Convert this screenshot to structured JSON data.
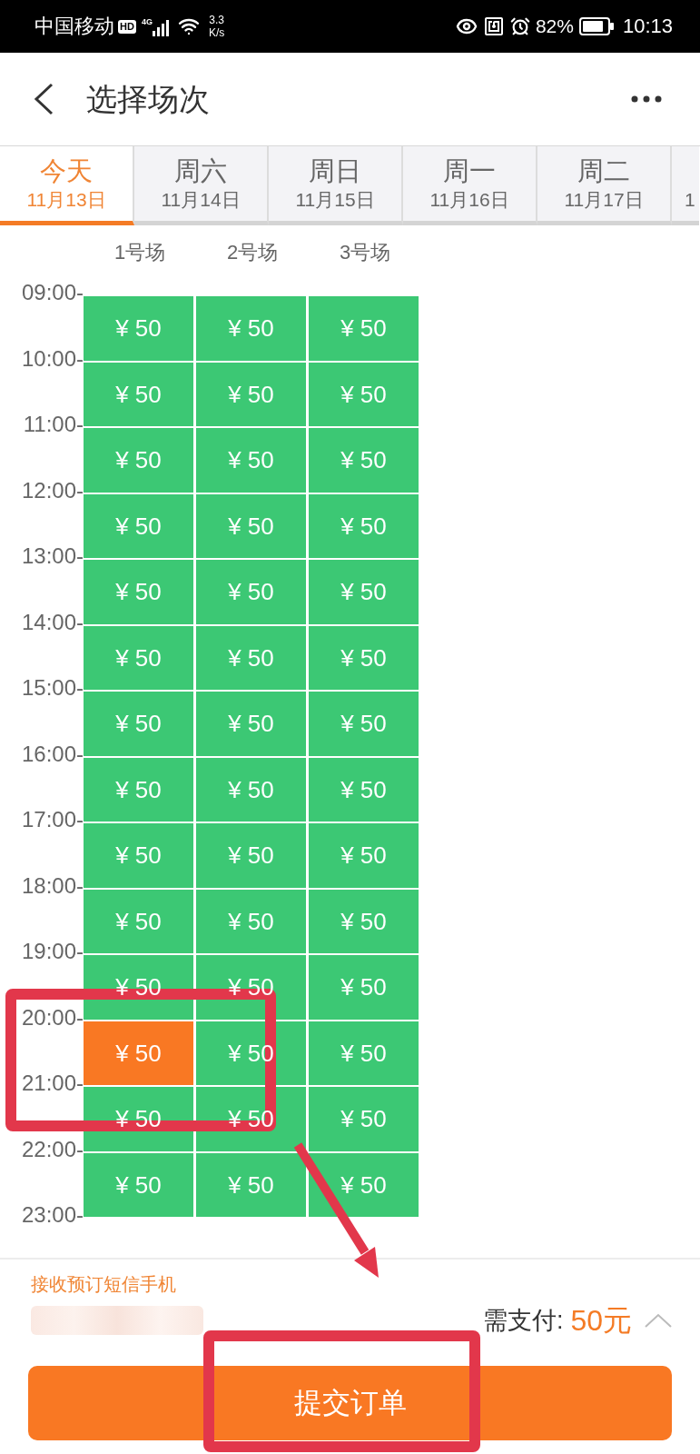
{
  "status_bar": {
    "carrier": "中国移动",
    "hd": "HD",
    "network": "4G",
    "speed": [
      "3.3",
      "K/s"
    ],
    "battery": "82%",
    "time": "10:13"
  },
  "header": {
    "title": "选择场次"
  },
  "date_tabs": [
    {
      "label": "今天",
      "date": "11月13日",
      "selected": true
    },
    {
      "label": "周六",
      "date": "11月14日",
      "selected": false
    },
    {
      "label": "周日",
      "date": "11月15日",
      "selected": false
    },
    {
      "label": "周一",
      "date": "11月16日",
      "selected": false
    },
    {
      "label": "周二",
      "date": "11月17日",
      "selected": false
    },
    {
      "date": "1",
      "selected": false
    }
  ],
  "courts": [
    "1号场",
    "2号场",
    "3号场"
  ],
  "times": [
    "09:00-",
    "10:00-",
    "11:00-",
    "12:00-",
    "13:00-",
    "14:00-",
    "15:00-",
    "16:00-",
    "17:00-",
    "18:00-",
    "19:00-",
    "20:00-",
    "21:00-",
    "22:00-",
    "23:00-"
  ],
  "slot_rows": [
    {
      "cells": [
        {
          "price": "¥ 50",
          "selected": false
        },
        {
          "price": "¥ 50",
          "selected": false
        },
        {
          "price": "¥ 50",
          "selected": false
        }
      ]
    },
    {
      "cells": [
        {
          "price": "¥ 50",
          "selected": false
        },
        {
          "price": "¥ 50",
          "selected": false
        },
        {
          "price": "¥ 50",
          "selected": false
        }
      ]
    },
    {
      "cells": [
        {
          "price": "¥ 50",
          "selected": false
        },
        {
          "price": "¥ 50",
          "selected": false
        },
        {
          "price": "¥ 50",
          "selected": false
        }
      ]
    },
    {
      "cells": [
        {
          "price": "¥ 50",
          "selected": false
        },
        {
          "price": "¥ 50",
          "selected": false
        },
        {
          "price": "¥ 50",
          "selected": false
        }
      ]
    },
    {
      "cells": [
        {
          "price": "¥ 50",
          "selected": false
        },
        {
          "price": "¥ 50",
          "selected": false
        },
        {
          "price": "¥ 50",
          "selected": false
        }
      ]
    },
    {
      "cells": [
        {
          "price": "¥ 50",
          "selected": false
        },
        {
          "price": "¥ 50",
          "selected": false
        },
        {
          "price": "¥ 50",
          "selected": false
        }
      ]
    },
    {
      "cells": [
        {
          "price": "¥ 50",
          "selected": false
        },
        {
          "price": "¥ 50",
          "selected": false
        },
        {
          "price": "¥ 50",
          "selected": false
        }
      ]
    },
    {
      "cells": [
        {
          "price": "¥ 50",
          "selected": false
        },
        {
          "price": "¥ 50",
          "selected": false
        },
        {
          "price": "¥ 50",
          "selected": false
        }
      ]
    },
    {
      "cells": [
        {
          "price": "¥ 50",
          "selected": false
        },
        {
          "price": "¥ 50",
          "selected": false
        },
        {
          "price": "¥ 50",
          "selected": false
        }
      ]
    },
    {
      "cells": [
        {
          "price": "¥ 50",
          "selected": false
        },
        {
          "price": "¥ 50",
          "selected": false
        },
        {
          "price": "¥ 50",
          "selected": false
        }
      ]
    },
    {
      "cells": [
        {
          "price": "¥ 50",
          "selected": false
        },
        {
          "price": "¥ 50",
          "selected": false
        },
        {
          "price": "¥ 50",
          "selected": false
        }
      ]
    },
    {
      "cells": [
        {
          "price": "¥ 50",
          "selected": true
        },
        {
          "price": "¥ 50",
          "selected": false
        },
        {
          "price": "¥ 50",
          "selected": false
        }
      ]
    },
    {
      "cells": [
        {
          "price": "¥ 50",
          "selected": false
        },
        {
          "price": "¥ 50",
          "selected": false
        },
        {
          "price": "¥ 50",
          "selected": false
        }
      ]
    },
    {
      "cells": [
        {
          "price": "¥ 50",
          "selected": false
        },
        {
          "price": "¥ 50",
          "selected": false
        },
        {
          "price": "¥ 50",
          "selected": false
        }
      ]
    }
  ],
  "footer": {
    "phone_label": "接收预订短信手机",
    "payment_label": "需支付:",
    "payment_amount": "50元",
    "submit": "提交订单"
  }
}
